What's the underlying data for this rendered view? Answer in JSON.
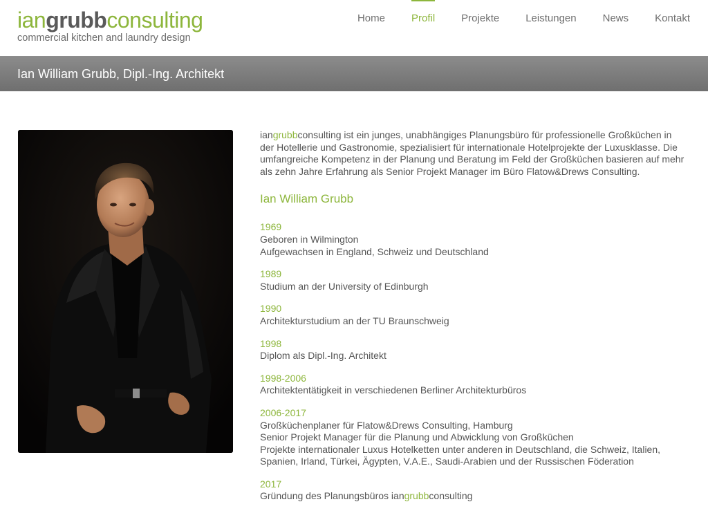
{
  "brand": {
    "part1": "ian",
    "part2": "grubb",
    "part3": "consulting",
    "tagline": "commercial kitchen and laundry design",
    "accent_color": "#8db63c"
  },
  "nav": {
    "items": [
      {
        "label": "Home",
        "active": false
      },
      {
        "label": "Profil",
        "active": true
      },
      {
        "label": "Projekte",
        "active": false
      },
      {
        "label": "Leistungen",
        "active": false
      },
      {
        "label": "News",
        "active": false
      },
      {
        "label": "Kontakt",
        "active": false
      }
    ]
  },
  "page": {
    "title": "Ian William Grubb, Dipl.-Ing. Architekt"
  },
  "intro": {
    "brand_a": "ian",
    "brand_b": "grubb",
    "brand_c": "consulting",
    "text": " ist ein junges, unabhängiges Planungsbüro für professionelle Großküchen in der Hotellerie und Gastronomie, spezialisiert für internationale Hotelprojekte der Luxusklasse. Die umfangreiche Kompetenz in der Planung und Beratung im Feld der Großküchen basieren auf mehr als zehn Jahre Erfahrung als Senior Projekt Manager im Büro Flatow&Drews Consulting."
  },
  "bio": {
    "heading": "Ian William Grubb",
    "entries": [
      {
        "year": "1969",
        "lines": [
          "Geboren in Wilmington",
          "Aufgewachsen in England, Schweiz und Deutschland"
        ]
      },
      {
        "year": "1989",
        "lines": [
          "Studium an der University of Edinburgh"
        ]
      },
      {
        "year": "1990",
        "lines": [
          "Architekturstudium an der TU Braunschweig"
        ]
      },
      {
        "year": "1998",
        "lines": [
          "Diplom als Dipl.-Ing. Architekt"
        ]
      },
      {
        "year": "1998-2006",
        "lines": [
          "Architektentätigkeit in verschiedenen Berliner Architekturbüros"
        ]
      },
      {
        "year": "2006-2017",
        "lines": [
          "Großküchenplaner für Flatow&Drews Consulting, Hamburg",
          "Senior Projekt Manager für die Planung und Abwicklung von Großküchen",
          "Projekte internationaler Luxus Hotelketten unter anderen in Deutschland, die Schweiz, Italien, Spanien, Irland, Türkei, Ägypten, V.A.E., Saudi-Arabien und der Russischen Föderation"
        ]
      }
    ],
    "last_entry": {
      "year": "2017",
      "text_before": "Gründung des Planungsbüros ",
      "brand_a": "ian",
      "brand_b": "grubb",
      "brand_c": "consulting"
    }
  }
}
